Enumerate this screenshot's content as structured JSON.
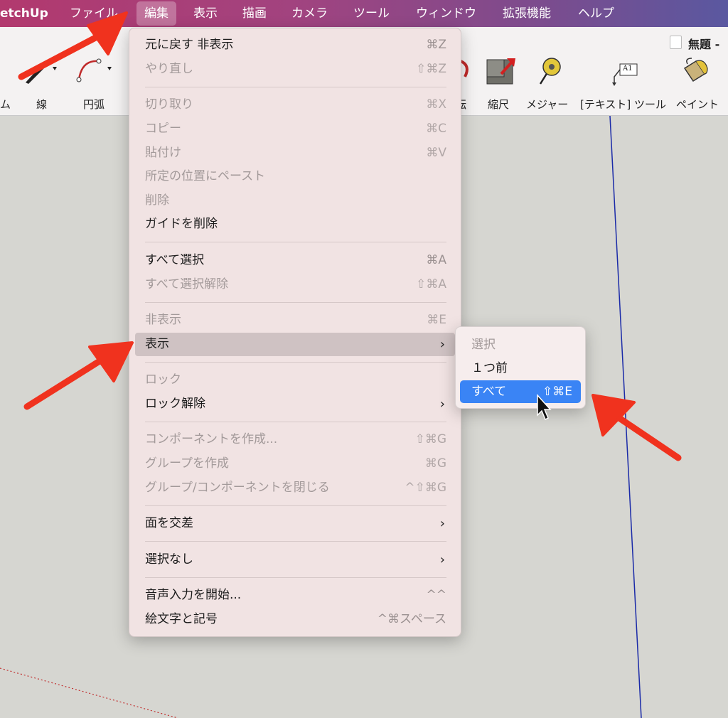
{
  "colors": {
    "accent": "#3a84f5",
    "arrow": "#f0321e",
    "axis_blue": "#1a2aa8",
    "axis_red": "#c03030"
  },
  "menubar": {
    "app_name": "etchUp",
    "items": [
      "ファイル",
      "編集",
      "表示",
      "描画",
      "カメラ",
      "ツール",
      "ウィンドウ",
      "拡張機能",
      "ヘルプ"
    ],
    "active": "編集"
  },
  "document": {
    "title": "無題 -"
  },
  "toolbar": {
    "tools": [
      {
        "label": "ム",
        "icon": "eraser-icon"
      },
      {
        "label": "線",
        "icon": "pencil-icon"
      },
      {
        "label": "円弧",
        "icon": "arc-icon"
      },
      {
        "label": "転",
        "icon": "rotate-icon"
      },
      {
        "label": "縮尺",
        "icon": "scale-icon"
      },
      {
        "label": "メジャー",
        "icon": "tape-measure-icon"
      },
      {
        "label": "[テキスト] ツール",
        "icon": "text-tool-icon"
      },
      {
        "label": "ペイント",
        "icon": "paint-bucket-icon"
      }
    ],
    "text_icon_glyph": "A1"
  },
  "edit_menu": {
    "items": [
      {
        "label": "元に戻す 非表示",
        "shortcut": "⌘Z",
        "enabled": true
      },
      {
        "label": "やり直し",
        "shortcut": "⇧⌘Z",
        "enabled": false
      },
      {
        "label": "切り取り",
        "shortcut": "⌘X",
        "enabled": false
      },
      {
        "label": "コピー",
        "shortcut": "⌘C",
        "enabled": false
      },
      {
        "label": "貼付け",
        "shortcut": "⌘V",
        "enabled": false
      },
      {
        "label": "所定の位置にペースト",
        "shortcut": "",
        "enabled": false
      },
      {
        "label": "削除",
        "shortcut": "",
        "enabled": false
      },
      {
        "label": "ガイドを削除",
        "shortcut": "",
        "enabled": true
      },
      {
        "label": "すべて選択",
        "shortcut": "⌘A",
        "enabled": true
      },
      {
        "label": "すべて選択解除",
        "shortcut": "⇧⌘A",
        "enabled": false
      },
      {
        "label": "非表示",
        "shortcut": "⌘E",
        "enabled": false
      },
      {
        "label": "表示",
        "shortcut": "",
        "enabled": true,
        "submenu": true,
        "highlighted": true
      },
      {
        "label": "ロック",
        "shortcut": "",
        "enabled": false
      },
      {
        "label": "ロック解除",
        "shortcut": "",
        "enabled": true,
        "submenu": true
      },
      {
        "label": "コンポーネントを作成...",
        "shortcut": "⇧⌘G",
        "enabled": false
      },
      {
        "label": "グループを作成",
        "shortcut": "⌘G",
        "enabled": false
      },
      {
        "label": "グループ/コンポーネントを閉じる",
        "shortcut": "^⇧⌘G",
        "enabled": false
      },
      {
        "label": "面を交差",
        "shortcut": "",
        "enabled": true,
        "submenu": true
      },
      {
        "label": "選択なし",
        "shortcut": "",
        "enabled": true,
        "submenu": true
      },
      {
        "label": "音声入力を開始...",
        "shortcut": "^^",
        "enabled": true
      },
      {
        "label": "絵文字と記号",
        "shortcut": "^⌘スペース",
        "enabled": true
      }
    ],
    "submenu_arrow": "›"
  },
  "show_submenu": {
    "items": [
      {
        "label": "選択",
        "shortcut": "",
        "enabled": false
      },
      {
        "label": "１つ前",
        "shortcut": "",
        "enabled": true
      },
      {
        "label": "すべて",
        "shortcut": "⇧⌘E",
        "enabled": true,
        "highlighted": true
      }
    ]
  }
}
